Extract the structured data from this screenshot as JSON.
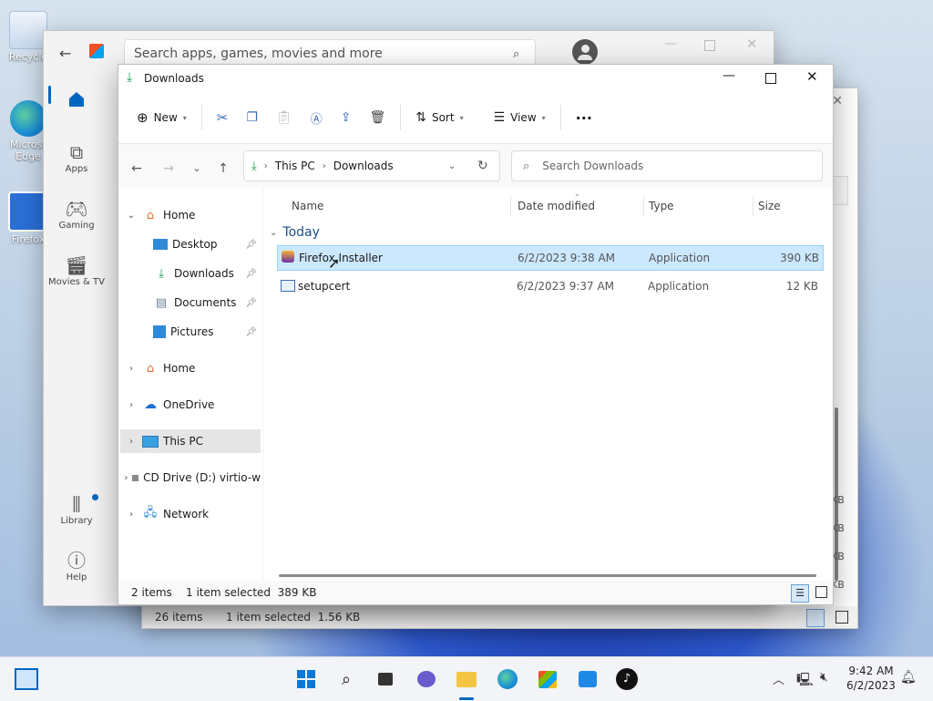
{
  "desktop": {
    "icons": [
      {
        "label": "Recycle",
        "icon": "recycle-bin-icon"
      },
      {
        "label": "Microsoft Edge",
        "icon": "edge-icon"
      },
      {
        "label": "Firefox",
        "icon": "firefox-icon"
      }
    ]
  },
  "background_window": {
    "status_items": "26 items",
    "status_selected": "1 item selected  1.56 KB",
    "partial_sizes": [
      "KB",
      "KB",
      "KB",
      "KB"
    ]
  },
  "store": {
    "search_placeholder": "Search apps, games, movies and more",
    "nav": [
      {
        "label": "Apps",
        "icon": "apps-icon"
      },
      {
        "label": "Gaming",
        "icon": "gaming-icon"
      },
      {
        "label": "Movies & TV",
        "icon": "movies-icon"
      },
      {
        "label": "Library",
        "icon": "library-icon"
      },
      {
        "label": "Help",
        "icon": "help-icon"
      }
    ]
  },
  "explorer": {
    "title": "Downloads",
    "toolbar": {
      "new_label": "New",
      "sort_label": "Sort",
      "view_label": "View",
      "more_label": "···"
    },
    "address": {
      "segments": [
        "This PC",
        "Downloads"
      ]
    },
    "search_placeholder": "Search Downloads",
    "navpane": {
      "items": [
        {
          "label": "Home",
          "expanded": true
        },
        {
          "label": "Desktop",
          "pinned": true
        },
        {
          "label": "Downloads",
          "pinned": true
        },
        {
          "label": "Documents",
          "pinned": true
        },
        {
          "label": "Pictures",
          "pinned": true
        },
        {
          "label": "Home"
        },
        {
          "label": "OneDrive"
        },
        {
          "label": "This PC",
          "selected": true
        },
        {
          "label": "CD Drive (D:) virtio-w"
        },
        {
          "label": "Network"
        }
      ]
    },
    "columns": {
      "name": "Name",
      "date": "Date modified",
      "type": "Type",
      "size": "Size"
    },
    "group_label": "Today",
    "files": [
      {
        "name": "Firefox Installer",
        "date": "6/2/2023 9:38 AM",
        "type": "Application",
        "size": "390 KB",
        "selected": true
      },
      {
        "name": "setupcert",
        "date": "6/2/2023 9:37 AM",
        "type": "Application",
        "size": "12 KB"
      }
    ],
    "status": {
      "items": "2 items",
      "selected": "1 item selected  389 KB"
    }
  },
  "taskbar": {
    "time": "9:42 AM",
    "date": "6/2/2023"
  },
  "colors": {
    "accent": "#0067c0",
    "selection": "#cce8ff",
    "nav_selected": "#e5e5e5"
  }
}
